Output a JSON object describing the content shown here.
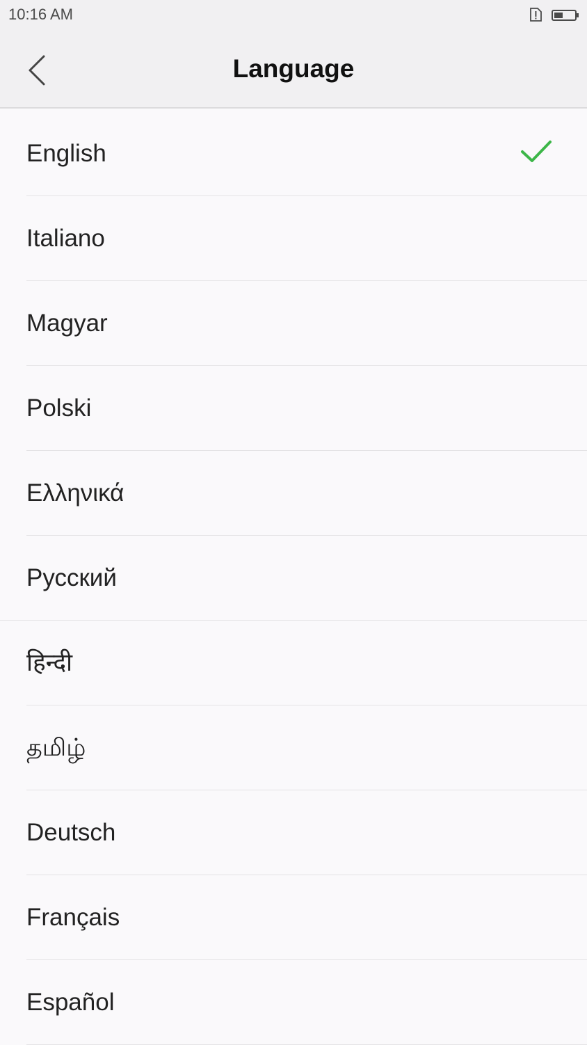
{
  "status_bar": {
    "time": "10:16 AM"
  },
  "header": {
    "title": "Language",
    "back_icon": "chevron-left-icon"
  },
  "languages": [
    {
      "label": "English",
      "selected": true
    },
    {
      "label": "Italiano",
      "selected": false
    },
    {
      "label": "Magyar",
      "selected": false
    },
    {
      "label": "Polski",
      "selected": false
    },
    {
      "label": "Ελληνικά",
      "selected": false
    },
    {
      "label": "Русский",
      "selected": false
    },
    {
      "label": "हिन्दी",
      "selected": false
    },
    {
      "label": "தமிழ்",
      "selected": false
    },
    {
      "label": "Deutsch",
      "selected": false
    },
    {
      "label": "Français",
      "selected": false
    },
    {
      "label": "Español",
      "selected": false
    }
  ],
  "colors": {
    "check": "#3cb648",
    "header_bg": "#f1f0f2",
    "list_bg": "#faf9fb"
  }
}
